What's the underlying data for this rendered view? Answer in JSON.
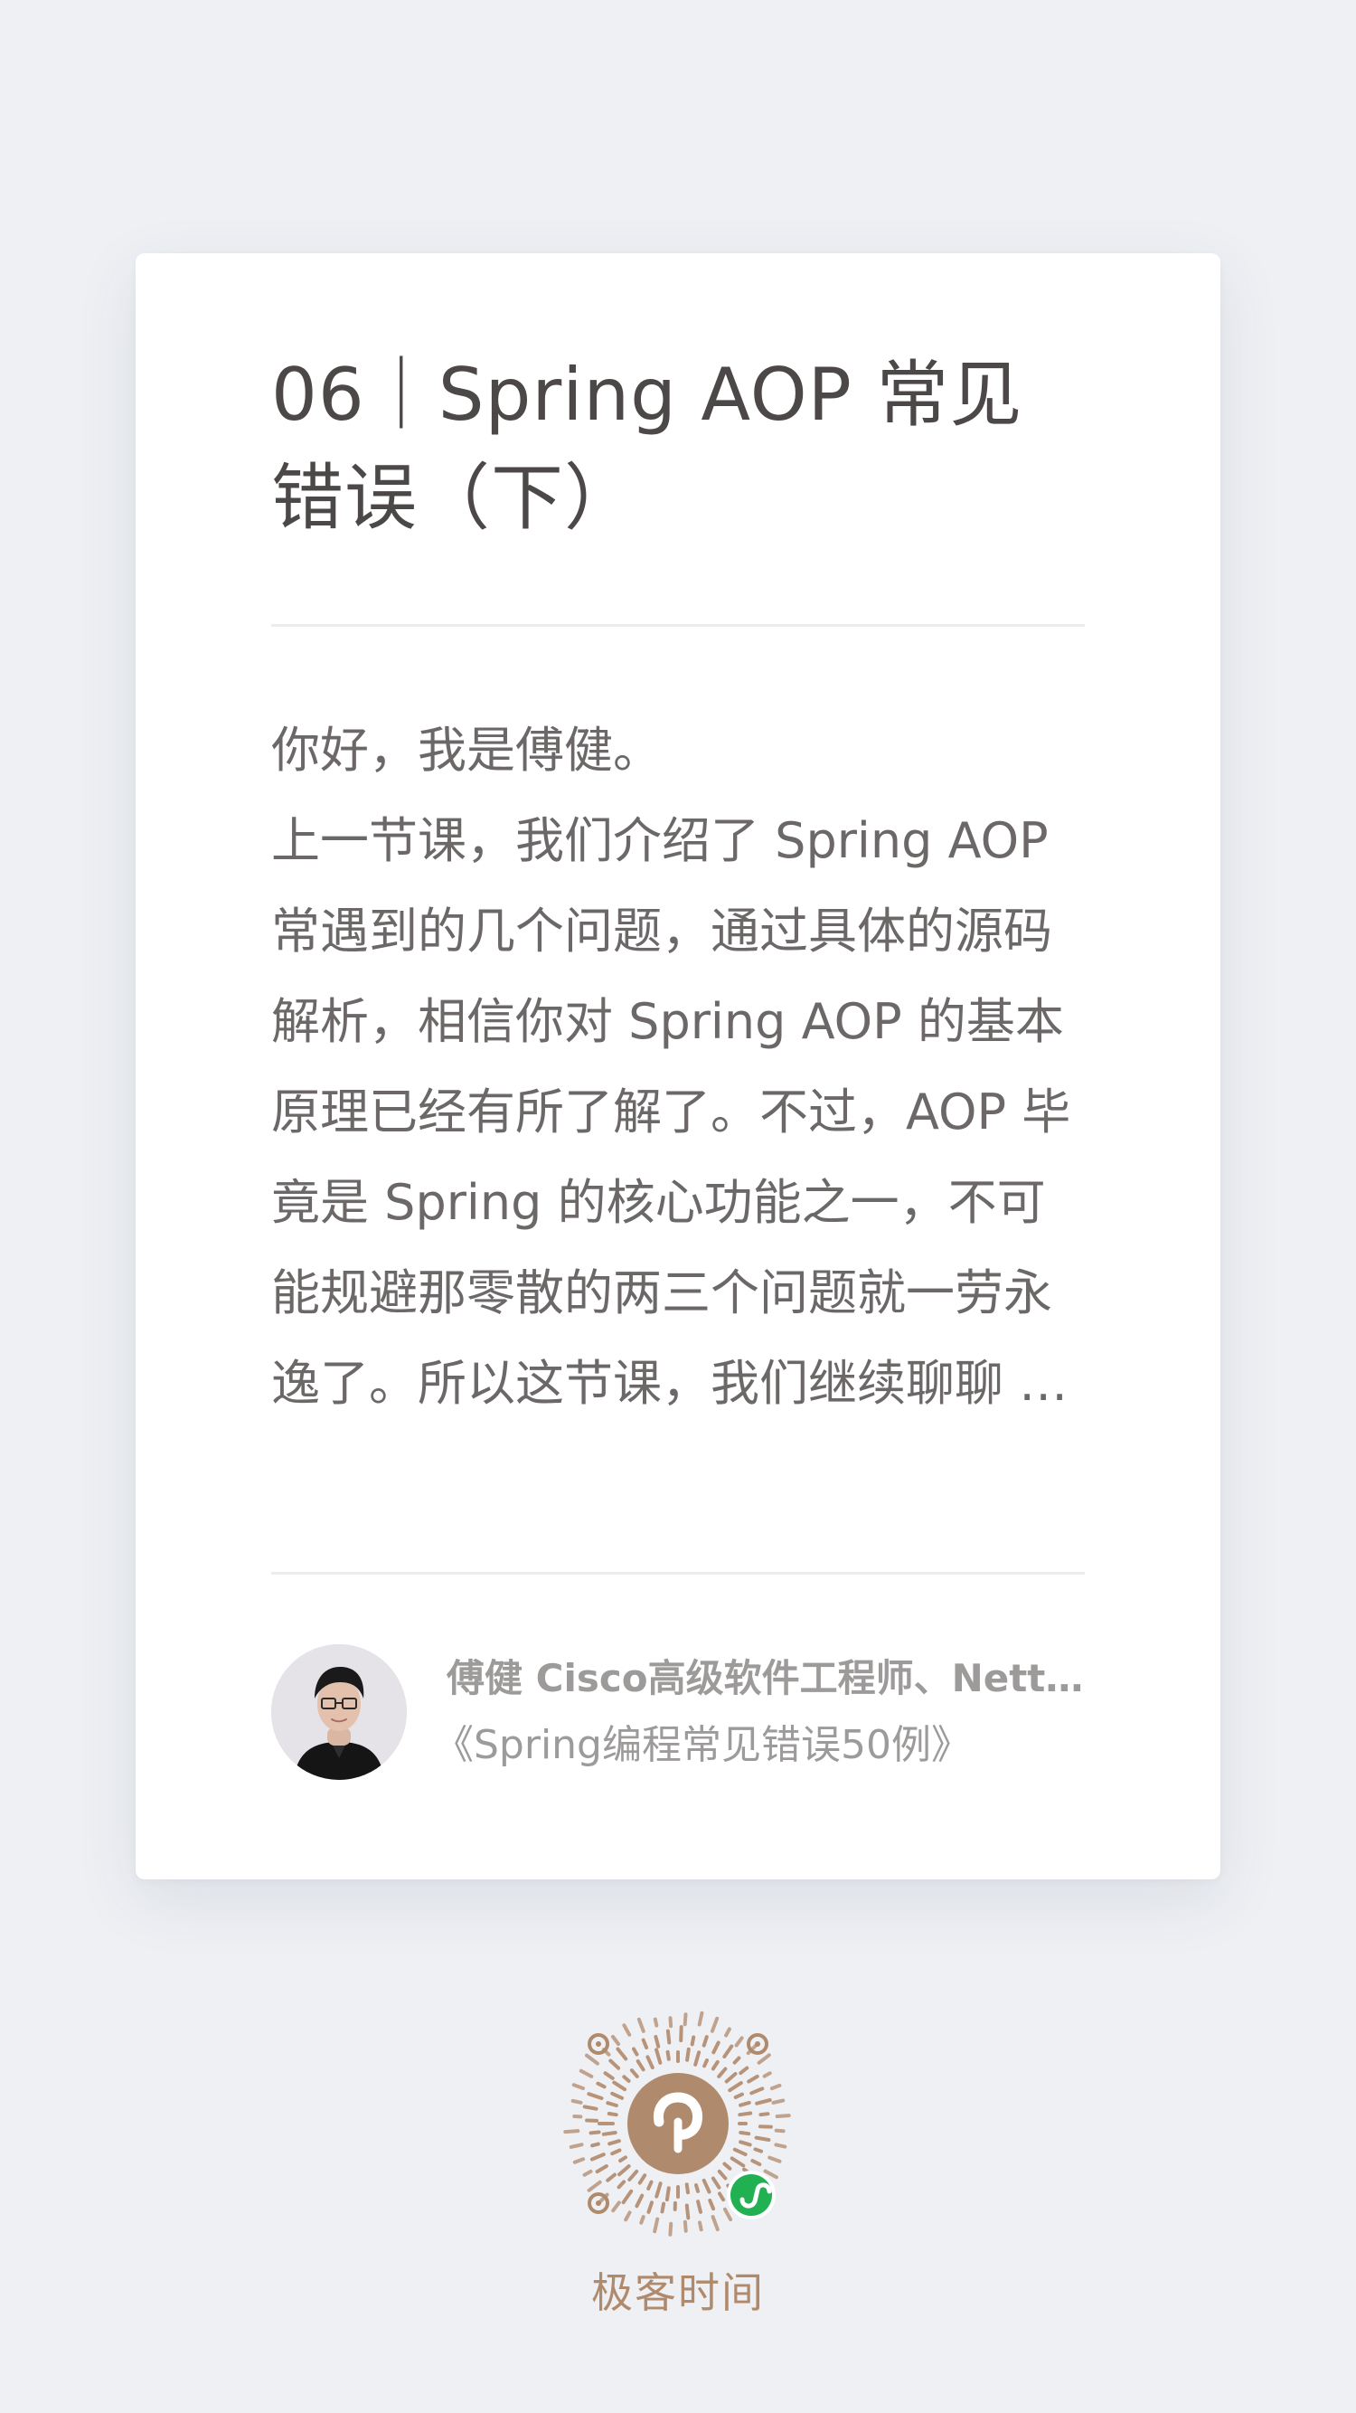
{
  "article": {
    "title": "06｜Spring AOP 常见错误（下）",
    "greeting": "你好，我是傅健。",
    "excerpt": "上一节课，我们介绍了 Spring AOP 常遇到的几个问题，通过具体的源码解析，相信你对 Spring AOP 的基本原理已经有所了解了。不过，AOP 毕竟是 Spring 的核心功能之一，不可能规避那零散的两三个问题就一劳永逸了。所以这节课，我们继续聊聊 Spring AOP 中的其他问题。"
  },
  "author": {
    "line": "傅健 Cisco高级软件工程师、Netty源码贡献者",
    "course": "《Spring编程常见错误50例》"
  },
  "footer": {
    "brand": "极客时间"
  },
  "colors": {
    "background": "#eef0f4",
    "card": "#ffffff",
    "title": "#4d4848",
    "body": "#6c6868",
    "meta": "#9d9a9a",
    "brand": "#b08a6c",
    "wechat_badge": "#21b152"
  },
  "icons": {
    "qr": "mini-program-code",
    "badge": "wechat-mini-program-icon"
  }
}
